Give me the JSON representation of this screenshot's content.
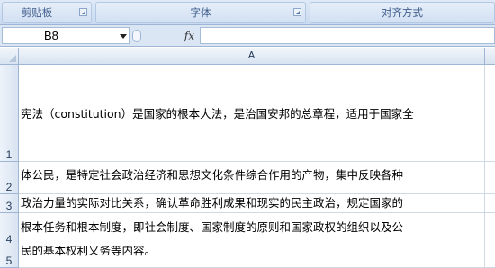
{
  "ribbon": {
    "groups": [
      {
        "label": "剪贴板"
      },
      {
        "label": "字体"
      },
      {
        "label": "对齐方式"
      }
    ]
  },
  "formula_bar": {
    "name_box": "B8",
    "fx_label": "fx",
    "formula_value": ""
  },
  "grid": {
    "column_header": "A",
    "rows": [
      {
        "number": "1",
        "text": "宪法（constitution）是国家的根本大法，是治国安邦的总章程，适用于国家全"
      },
      {
        "number": "2",
        "text": "体公民，是特定社会政治经济和思想文化条件综合作用的产物，集中反映各种"
      },
      {
        "number": "3",
        "text": "政治力量的实际对比关系，确认革命胜利成果和现实的民主政治，规定国家的"
      },
      {
        "number": "4",
        "text": "根本任务和根本制度，即社会制度、国家制度的原则和国家政权的组织以及公"
      },
      {
        "number": "5",
        "text": "民的基本权利义务等内容。"
      }
    ]
  }
}
